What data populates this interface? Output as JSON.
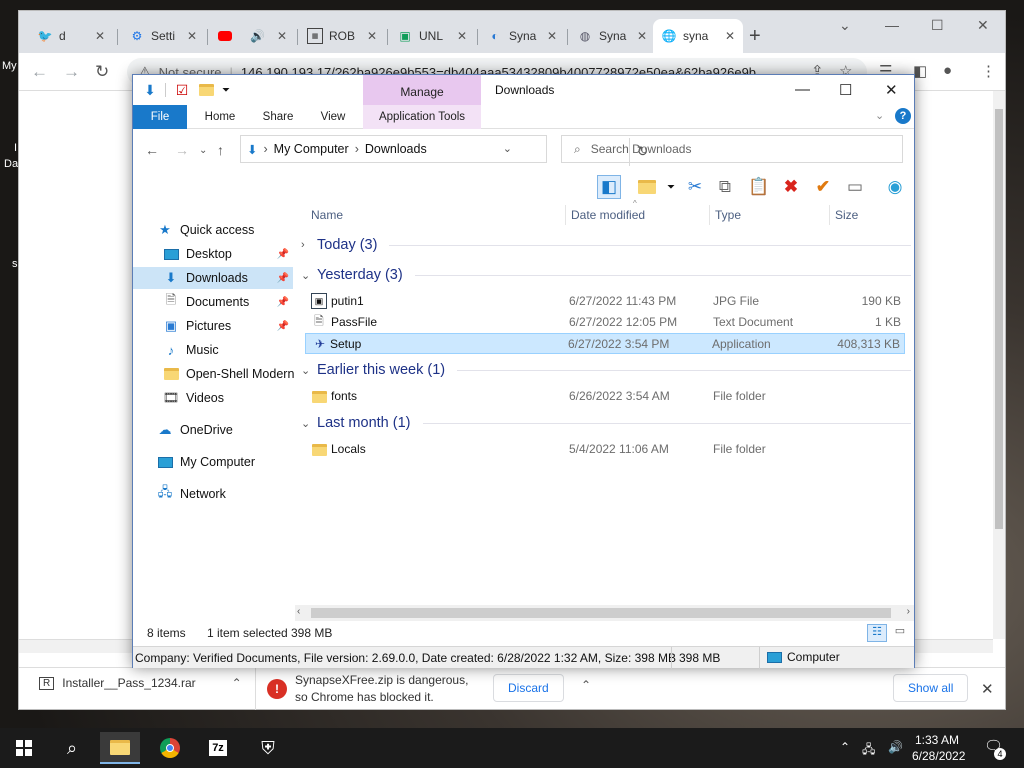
{
  "desktop": {
    "label1": "My",
    "label2": "I",
    "label3": "Da",
    "label4": "s"
  },
  "chrome": {
    "tabs": [
      {
        "title": "d",
        "icon": "twitter-icon"
      },
      {
        "title": "Setti",
        "icon": "gear-icon"
      },
      {
        "title": "",
        "icon": "youtube-icon"
      },
      {
        "title": "ROB",
        "icon": "roblox-icon"
      },
      {
        "title": "UNL",
        "icon": "unl-icon"
      },
      {
        "title": "Syna",
        "icon": "synapse-icon"
      },
      {
        "title": "Syna",
        "icon": "synapse2-icon"
      },
      {
        "title": "syna",
        "icon": "globe-icon"
      }
    ],
    "url_warning": "Not secure",
    "url": "146.190.193.17/?62ba926e9b553=db404aaa53432809b4007728972e50ea&62ba926e9b",
    "download": {
      "file1": "Installer__Pass_1234.rar",
      "blocked_line1": "SynapseXFree.zip is dangerous,",
      "blocked_line2": "so Chrome has blocked it.",
      "discard": "Discard",
      "show_all": "Show all"
    }
  },
  "explorer": {
    "title": "Downloads",
    "manage": "Manage",
    "ribbon": {
      "file": "File",
      "home": "Home",
      "share": "Share",
      "view": "View",
      "app_tools": "Application Tools"
    },
    "path": {
      "root": "My Computer",
      "current": "Downloads"
    },
    "search_placeholder": "Search Downloads",
    "nav": {
      "quick_access": "Quick access",
      "desktop": "Desktop",
      "downloads": "Downloads",
      "documents": "Documents",
      "pictures": "Pictures",
      "music": "Music",
      "openshell": "Open-Shell Modern",
      "videos": "Videos",
      "onedrive": "OneDrive",
      "mycomputer": "My Computer",
      "network": "Network"
    },
    "columns": {
      "name": "Name",
      "date": "Date modified",
      "type": "Type",
      "size": "Size"
    },
    "groups": {
      "today": "Today (3)",
      "yesterday": "Yesterday (3)",
      "week": "Earlier this week (1)",
      "month": "Last month (1)"
    },
    "files": [
      {
        "name": "putin1",
        "date": "6/27/2022 11:43 PM",
        "type": "JPG File",
        "size": "190 KB"
      },
      {
        "name": "PassFile",
        "date": "6/27/2022 12:05 PM",
        "type": "Text Document",
        "size": "1 KB"
      },
      {
        "name": "Setup",
        "date": "6/27/2022 3:54 PM",
        "type": "Application",
        "size": "408,313 KB"
      },
      {
        "name": "fonts",
        "date": "6/26/2022 3:54 AM",
        "type": "File folder",
        "size": ""
      },
      {
        "name": "Locals",
        "date": "5/4/2022 11:06 AM",
        "type": "File folder",
        "size": ""
      }
    ],
    "status": {
      "items": "8 items",
      "selected": "1 item selected",
      "selected_size": "398 MB"
    },
    "details": {
      "info": "Company: Verified Documents, File version: 2.69.0.0, Date created: 6/28/2022 1:32 AM, Size: 398 MB",
      "size": "398 MB",
      "location": "Computer"
    }
  },
  "taskbar": {
    "time": "1:33 AM",
    "date": "6/28/2022",
    "notif_count": "4"
  }
}
